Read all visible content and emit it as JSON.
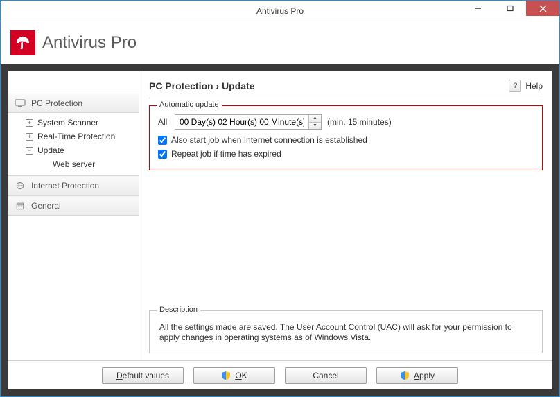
{
  "titlebar": {
    "title": "Antivirus Pro"
  },
  "header": {
    "title": "Antivirus Pro"
  },
  "breadcrumb": {
    "section": "PC Protection",
    "page": "Update"
  },
  "help": {
    "label": "Help"
  },
  "sidebar": {
    "pc_protection": {
      "label": "PC Protection",
      "items": {
        "system_scanner": "System Scanner",
        "realtime": "Real-Time Protection",
        "update": "Update",
        "web_server": "Web server"
      }
    },
    "internet_protection": {
      "label": "Internet Protection"
    },
    "general": {
      "label": "General"
    }
  },
  "automatic_update": {
    "legend": "Automatic update",
    "lead": "All",
    "interval": "00 Day(s) 02 Hour(s) 00 Minute(s)",
    "hint": "(min. 15 minutes)",
    "cb_start_on_connection": "Also start job when Internet connection is established",
    "cb_repeat_expired": "Repeat job if time has expired"
  },
  "description": {
    "legend": "Description",
    "text": "All the settings made are saved. The User Account Control (UAC) will ask for your permission to apply changes in operating systems as of Windows Vista."
  },
  "footer": {
    "default_values": "Default values",
    "ok": "OK",
    "cancel": "Cancel",
    "apply": "Apply"
  }
}
